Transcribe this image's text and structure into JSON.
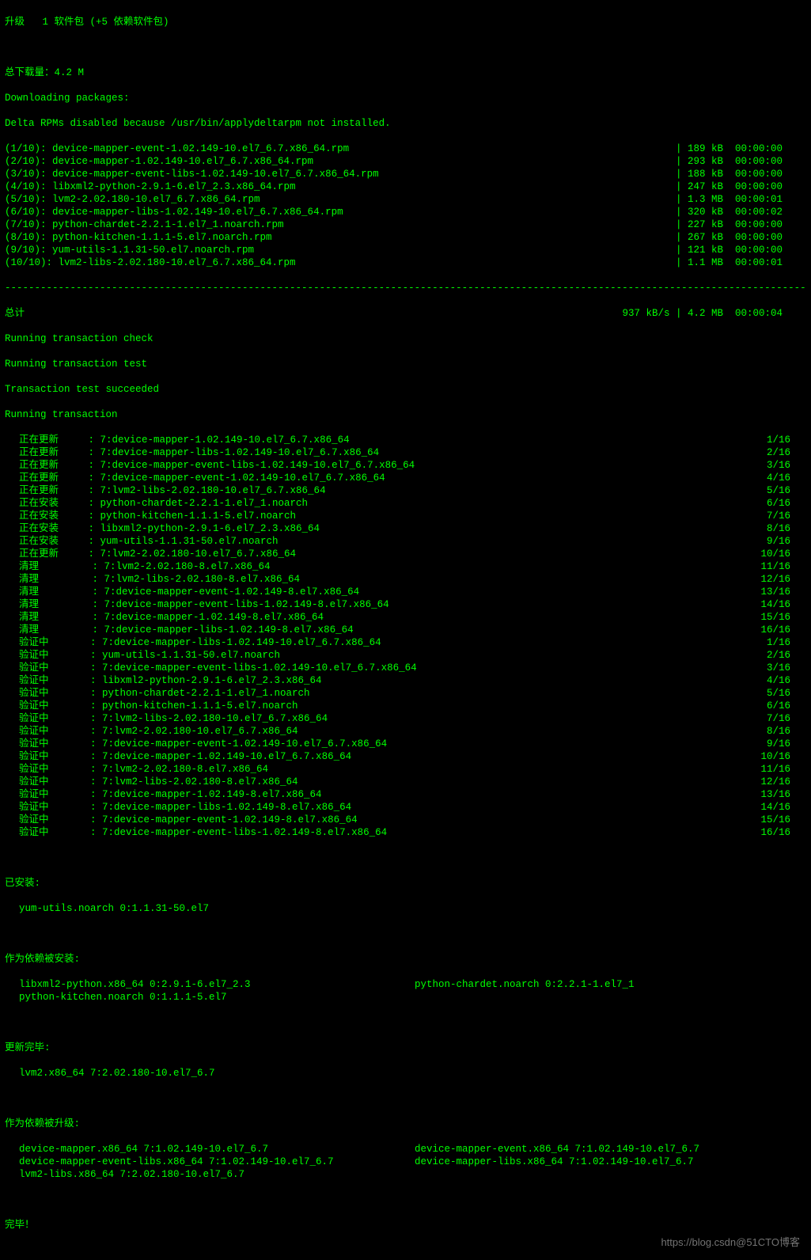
{
  "header": {
    "upgrade_line": "升级   1 软件包 (+5 依赖软件包)",
    "total_dl": "总下载量：4.2 M",
    "dl_packages": "Downloading packages:",
    "delta": "Delta RPMs disabled because /usr/bin/applydeltarpm not installed."
  },
  "downloads": [
    {
      "idx": "(1/10): device-mapper-event-1.02.149-10.el7_6.7.x86_64.rpm",
      "bar": "| 189 kB  00:00:00"
    },
    {
      "idx": "(2/10): device-mapper-1.02.149-10.el7_6.7.x86_64.rpm",
      "bar": "| 293 kB  00:00:00"
    },
    {
      "idx": "(3/10): device-mapper-event-libs-1.02.149-10.el7_6.7.x86_64.rpm",
      "bar": "| 188 kB  00:00:00"
    },
    {
      "idx": "(4/10): libxml2-python-2.9.1-6.el7_2.3.x86_64.rpm",
      "bar": "| 247 kB  00:00:00"
    },
    {
      "idx": "(5/10): lvm2-2.02.180-10.el7_6.7.x86_64.rpm",
      "bar": "| 1.3 MB  00:00:01"
    },
    {
      "idx": "(6/10): device-mapper-libs-1.02.149-10.el7_6.7.x86_64.rpm",
      "bar": "| 320 kB  00:00:02"
    },
    {
      "idx": "(7/10): python-chardet-2.2.1-1.el7_1.noarch.rpm",
      "bar": "| 227 kB  00:00:00"
    },
    {
      "idx": "(8/10): python-kitchen-1.1.1-5.el7.noarch.rpm",
      "bar": "| 267 kB  00:00:00"
    },
    {
      "idx": "(9/10): yum-utils-1.1.31-50.el7.noarch.rpm",
      "bar": "| 121 kB  00:00:00"
    },
    {
      "idx": "(10/10): lvm2-libs-2.02.180-10.el7_6.7.x86_64.rpm",
      "bar": "| 1.1 MB  00:00:01"
    }
  ],
  "total_line": {
    "label": "总计",
    "stats": "937 kB/s | 4.2 MB  00:00:04"
  },
  "trans": {
    "check": "Running transaction check",
    "test": "Running transaction test",
    "succeeded": "Transaction test succeeded",
    "running": "Running transaction"
  },
  "steps": [
    {
      "a": "正在更新",
      "p": ": 7:device-mapper-1.02.149-10.el7_6.7.x86_64",
      "n": "1/16"
    },
    {
      "a": "正在更新",
      "p": ": 7:device-mapper-libs-1.02.149-10.el7_6.7.x86_64",
      "n": "2/16"
    },
    {
      "a": "正在更新",
      "p": ": 7:device-mapper-event-libs-1.02.149-10.el7_6.7.x86_64",
      "n": "3/16"
    },
    {
      "a": "正在更新",
      "p": ": 7:device-mapper-event-1.02.149-10.el7_6.7.x86_64",
      "n": "4/16"
    },
    {
      "a": "正在更新",
      "p": ": 7:lvm2-libs-2.02.180-10.el7_6.7.x86_64",
      "n": "5/16"
    },
    {
      "a": "正在安装",
      "p": ": python-chardet-2.2.1-1.el7_1.noarch",
      "n": "6/16"
    },
    {
      "a": "正在安装",
      "p": ": python-kitchen-1.1.1-5.el7.noarch",
      "n": "7/16"
    },
    {
      "a": "正在安装",
      "p": ": libxml2-python-2.9.1-6.el7_2.3.x86_64",
      "n": "8/16"
    },
    {
      "a": "正在安装",
      "p": ": yum-utils-1.1.31-50.el7.noarch",
      "n": "9/16"
    },
    {
      "a": "正在更新",
      "p": ": 7:lvm2-2.02.180-10.el7_6.7.x86_64",
      "n": "10/16"
    },
    {
      "a": "清理",
      "p": ": 7:lvm2-2.02.180-8.el7.x86_64",
      "n": "11/16"
    },
    {
      "a": "清理",
      "p": ": 7:lvm2-libs-2.02.180-8.el7.x86_64",
      "n": "12/16"
    },
    {
      "a": "清理",
      "p": ": 7:device-mapper-event-1.02.149-8.el7.x86_64",
      "n": "13/16"
    },
    {
      "a": "清理",
      "p": ": 7:device-mapper-event-libs-1.02.149-8.el7.x86_64",
      "n": "14/16"
    },
    {
      "a": "清理",
      "p": ": 7:device-mapper-1.02.149-8.el7.x86_64",
      "n": "15/16"
    },
    {
      "a": "清理",
      "p": ": 7:device-mapper-libs-1.02.149-8.el7.x86_64",
      "n": "16/16"
    },
    {
      "a": "验证中",
      "p": ": 7:device-mapper-libs-1.02.149-10.el7_6.7.x86_64",
      "n": "1/16"
    },
    {
      "a": "验证中",
      "p": ": yum-utils-1.1.31-50.el7.noarch",
      "n": "2/16"
    },
    {
      "a": "验证中",
      "p": ": 7:device-mapper-event-libs-1.02.149-10.el7_6.7.x86_64",
      "n": "3/16"
    },
    {
      "a": "验证中",
      "p": ": libxml2-python-2.9.1-6.el7_2.3.x86_64",
      "n": "4/16"
    },
    {
      "a": "验证中",
      "p": ": python-chardet-2.2.1-1.el7_1.noarch",
      "n": "5/16"
    },
    {
      "a": "验证中",
      "p": ": python-kitchen-1.1.1-5.el7.noarch",
      "n": "6/16"
    },
    {
      "a": "验证中",
      "p": ": 7:lvm2-libs-2.02.180-10.el7_6.7.x86_64",
      "n": "7/16"
    },
    {
      "a": "验证中",
      "p": ": 7:lvm2-2.02.180-10.el7_6.7.x86_64",
      "n": "8/16"
    },
    {
      "a": "验证中",
      "p": ": 7:device-mapper-event-1.02.149-10.el7_6.7.x86_64",
      "n": "9/16"
    },
    {
      "a": "验证中",
      "p": ": 7:device-mapper-1.02.149-10.el7_6.7.x86_64",
      "n": "10/16"
    },
    {
      "a": "验证中",
      "p": ": 7:lvm2-2.02.180-8.el7.x86_64",
      "n": "11/16"
    },
    {
      "a": "验证中",
      "p": ": 7:lvm2-libs-2.02.180-8.el7.x86_64",
      "n": "12/16"
    },
    {
      "a": "验证中",
      "p": ": 7:device-mapper-1.02.149-8.el7.x86_64",
      "n": "13/16"
    },
    {
      "a": "验证中",
      "p": ": 7:device-mapper-libs-1.02.149-8.el7.x86_64",
      "n": "14/16"
    },
    {
      "a": "验证中",
      "p": ": 7:device-mapper-event-1.02.149-8.el7.x86_64",
      "n": "15/16"
    },
    {
      "a": "验证中",
      "p": ": 7:device-mapper-event-libs-1.02.149-8.el7.x86_64",
      "n": "16/16"
    }
  ],
  "installed": {
    "label": "已安装:",
    "items": [
      "yum-utils.noarch 0:1.1.31-50.el7"
    ]
  },
  "dep_installed": {
    "label": "作为依赖被安装:",
    "col1": [
      "libxml2-python.x86_64 0:2.9.1-6.el7_2.3",
      "python-kitchen.noarch 0:1.1.1-5.el7"
    ],
    "col2": [
      "python-chardet.noarch 0:2.2.1-1.el7_1",
      ""
    ]
  },
  "updated": {
    "label": "更新完毕:",
    "items": [
      "lvm2.x86_64 7:2.02.180-10.el7_6.7"
    ]
  },
  "dep_updated": {
    "label": "作为依赖被升级:",
    "col1": [
      "device-mapper.x86_64 7:1.02.149-10.el7_6.7",
      "device-mapper-event-libs.x86_64 7:1.02.149-10.el7_6.7",
      "lvm2-libs.x86_64 7:2.02.180-10.el7_6.7"
    ],
    "col2": [
      "device-mapper-event.x86_64 7:1.02.149-10.el7_6.7",
      "device-mapper-libs.x86_64 7:1.02.149-10.el7_6.7",
      ""
    ]
  },
  "complete": "完毕！",
  "watermark": "https://blog.csdn@51CTO博客"
}
